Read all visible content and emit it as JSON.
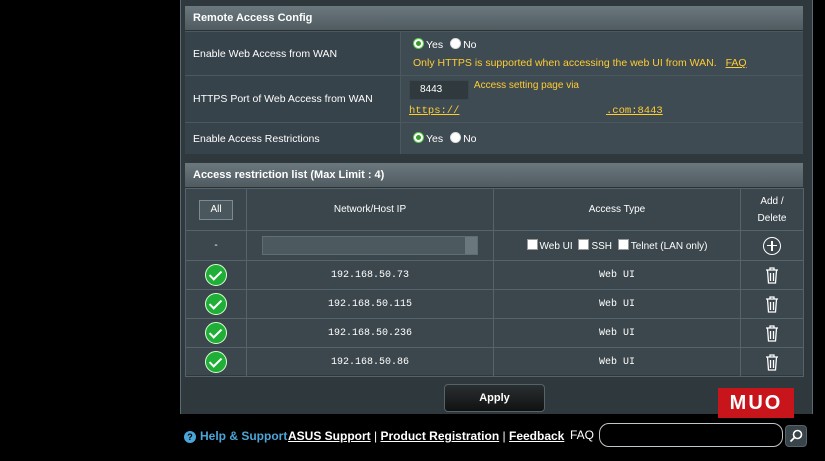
{
  "remote_access": {
    "title": "Remote Access Config",
    "web_access": {
      "label": "Enable Web Access from WAN",
      "yes": "Yes",
      "no": "No",
      "selected": "Yes",
      "note": "Only HTTPS is supported when accessing the web UI from WAN.",
      "faq": "FAQ"
    },
    "https_port": {
      "label": "HTTPS Port of Web Access from WAN",
      "value": "8443",
      "hint": "Access setting page via",
      "url_prefix": "https://",
      "url_suffix": ".com:8443"
    },
    "access_restrictions": {
      "label": "Enable Access Restrictions",
      "yes": "Yes",
      "no": "No",
      "selected": "Yes"
    }
  },
  "restriction_list": {
    "title": "Access restriction list (Max Limit : 4)",
    "headers": {
      "all": "All",
      "ip": "Network/Host IP",
      "type": "Access Type",
      "add_delete_1": "Add /",
      "add_delete_2": "Delete"
    },
    "input_row": {
      "dash": "-",
      "opt_webui": "Web UI",
      "opt_ssh": "SSH",
      "opt_telnet": "Telnet (LAN only)"
    },
    "rows": [
      {
        "ip": "192.168.50.73",
        "type": "Web UI"
      },
      {
        "ip": "192.168.50.115",
        "type": "Web UI"
      },
      {
        "ip": "192.168.50.236",
        "type": "Web UI"
      },
      {
        "ip": "192.168.50.86",
        "type": "Web UI"
      }
    ]
  },
  "apply_label": "Apply",
  "footer": {
    "help": "Help & Support",
    "asus_support": "ASUS Support",
    "product_registration": "Product Registration",
    "feedback": "Feedback",
    "sep": "|",
    "faq": "FAQ"
  },
  "watermark": "MUO",
  "colors": {
    "accent": "#ffcc33",
    "check": "#1fae36",
    "help": "#4aa5d8"
  }
}
